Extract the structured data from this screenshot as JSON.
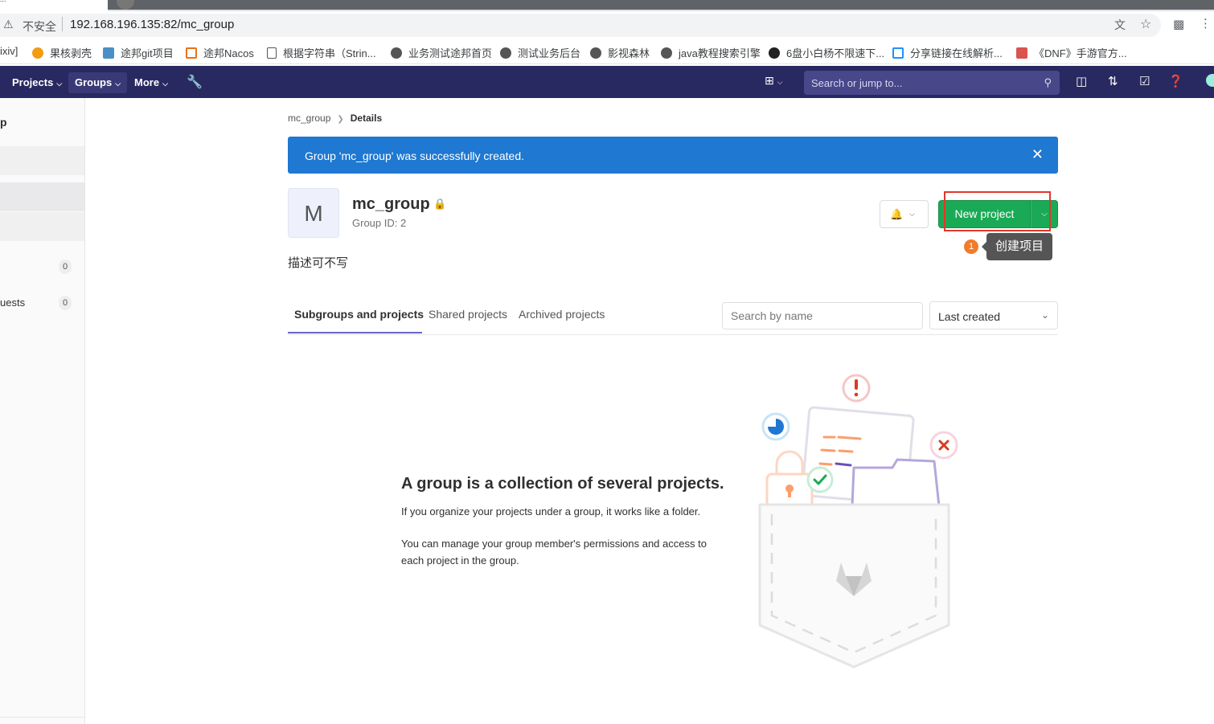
{
  "browser": {
    "tab_fragment": "...",
    "security_label": "不安全",
    "url": "192.168.196.135:82/mc_group",
    "bookmarks": [
      {
        "label": "ixiv]"
      },
      {
        "label": "果核剥壳"
      },
      {
        "label": "途邦git项目"
      },
      {
        "label": "途邦Nacos"
      },
      {
        "label": "根据字符串（Strin..."
      },
      {
        "label": "业务测试途邦首页"
      },
      {
        "label": "测试业务后台"
      },
      {
        "label": "影视森林"
      },
      {
        "label": "java教程搜索引擎"
      },
      {
        "label": "6盘小白杨不限速下..."
      },
      {
        "label": "分享链接在线解析..."
      },
      {
        "label": "《DNF》手游官方..."
      }
    ]
  },
  "nav": {
    "projects": "Projects",
    "groups": "Groups",
    "more": "More",
    "search_placeholder": "Search or jump to..."
  },
  "sidebar": {
    "title": "p",
    "badges": [
      {
        "label": "",
        "count": "0"
      },
      {
        "label": "uests",
        "count": "0"
      }
    ]
  },
  "breadcrumb": {
    "parent": "mc_group",
    "current": "Details"
  },
  "flash": {
    "message": "Group 'mc_group' was successfully created."
  },
  "group": {
    "avatar_letter": "M",
    "name": "mc_group",
    "id_text": "Group ID: 2",
    "description": "描述可不写"
  },
  "actions": {
    "new_project": "New project",
    "annotation_number": "1",
    "annotation_tooltip": "创建项目"
  },
  "tabs": [
    {
      "label": "Subgroups and projects"
    },
    {
      "label": "Shared projects"
    },
    {
      "label": "Archived projects"
    }
  ],
  "filter": {
    "placeholder": "Search by name",
    "sort_selected": "Last created"
  },
  "empty_state": {
    "title": "A group is a collection of several projects.",
    "line1": "If you organize your projects under a group, it works like a folder.",
    "line2": "You can manage your group member's permissions and access to each project in the group."
  },
  "colors": {
    "nav_bg": "#292961",
    "flash_bg": "#1f78d1",
    "new_project_bg": "#1aaa55",
    "annotation_box": "#e0372d",
    "annotation_number_bg": "#f07c2a",
    "tab_underline": "#6666c4"
  }
}
